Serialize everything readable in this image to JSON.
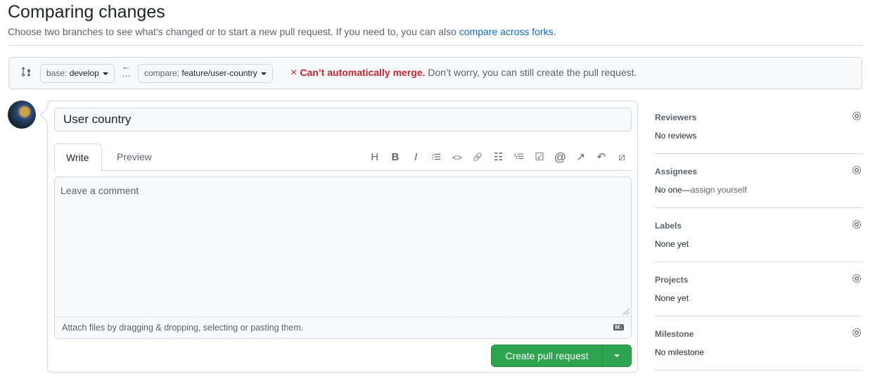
{
  "header": {
    "title": "Comparing changes",
    "subtitle": "Choose two branches to see what’s changed or to start a new pull request. If you need to, you can also ",
    "subtitle_link": "compare across forks."
  },
  "range": {
    "base_key": "base:",
    "base_value": "develop",
    "compare_key": "compare:",
    "compare_value": "feature/user-country",
    "status_icon": "×",
    "status_bold": "Can’t automatically merge.",
    "status_text": " Don’t worry, you can still create the pull request."
  },
  "form": {
    "title_value": "User country",
    "tabs": [
      "Write",
      "Preview"
    ],
    "toolbar": [
      {
        "icon": "heading-icon",
        "glyph": "H"
      },
      {
        "icon": "bold-icon",
        "glyph": "B"
      },
      {
        "icon": "italic-icon",
        "glyph": "I"
      },
      {
        "icon": "quote-icon",
        "glyph": "⁞☰"
      },
      {
        "icon": "code-icon",
        "glyph": "<>"
      },
      {
        "icon": "link-icon",
        "glyph": "🔗"
      },
      {
        "icon": "unordered-list-icon",
        "glyph": "☷"
      },
      {
        "icon": "ordered-list-icon",
        "glyph": "⅟☰"
      },
      {
        "icon": "task-list-icon",
        "glyph": "☑"
      },
      {
        "icon": "mention-icon",
        "glyph": "@"
      },
      {
        "icon": "cross-reference-icon",
        "glyph": "↗"
      },
      {
        "icon": "reply-icon",
        "glyph": "↶"
      },
      {
        "icon": "slash-commands-icon",
        "glyph": "⧄"
      }
    ],
    "comment_placeholder": "Leave a comment",
    "attach_text": "Attach files by dragging & dropping, selecting or pasting them.",
    "markdown_badge": "M↓",
    "submit_label": "Create pull request"
  },
  "sidebar": [
    {
      "title": "Reviewers",
      "value": "No reviews"
    },
    {
      "title": "Assignees",
      "value": "No one—",
      "link": "assign yourself"
    },
    {
      "title": "Labels",
      "value": "None yet"
    },
    {
      "title": "Projects",
      "value": "None yet"
    },
    {
      "title": "Milestone",
      "value": "No milestone"
    }
  ],
  "colors": {
    "accent": "#0969da",
    "danger": "#d1242f",
    "primary_button": "#2da44e"
  }
}
